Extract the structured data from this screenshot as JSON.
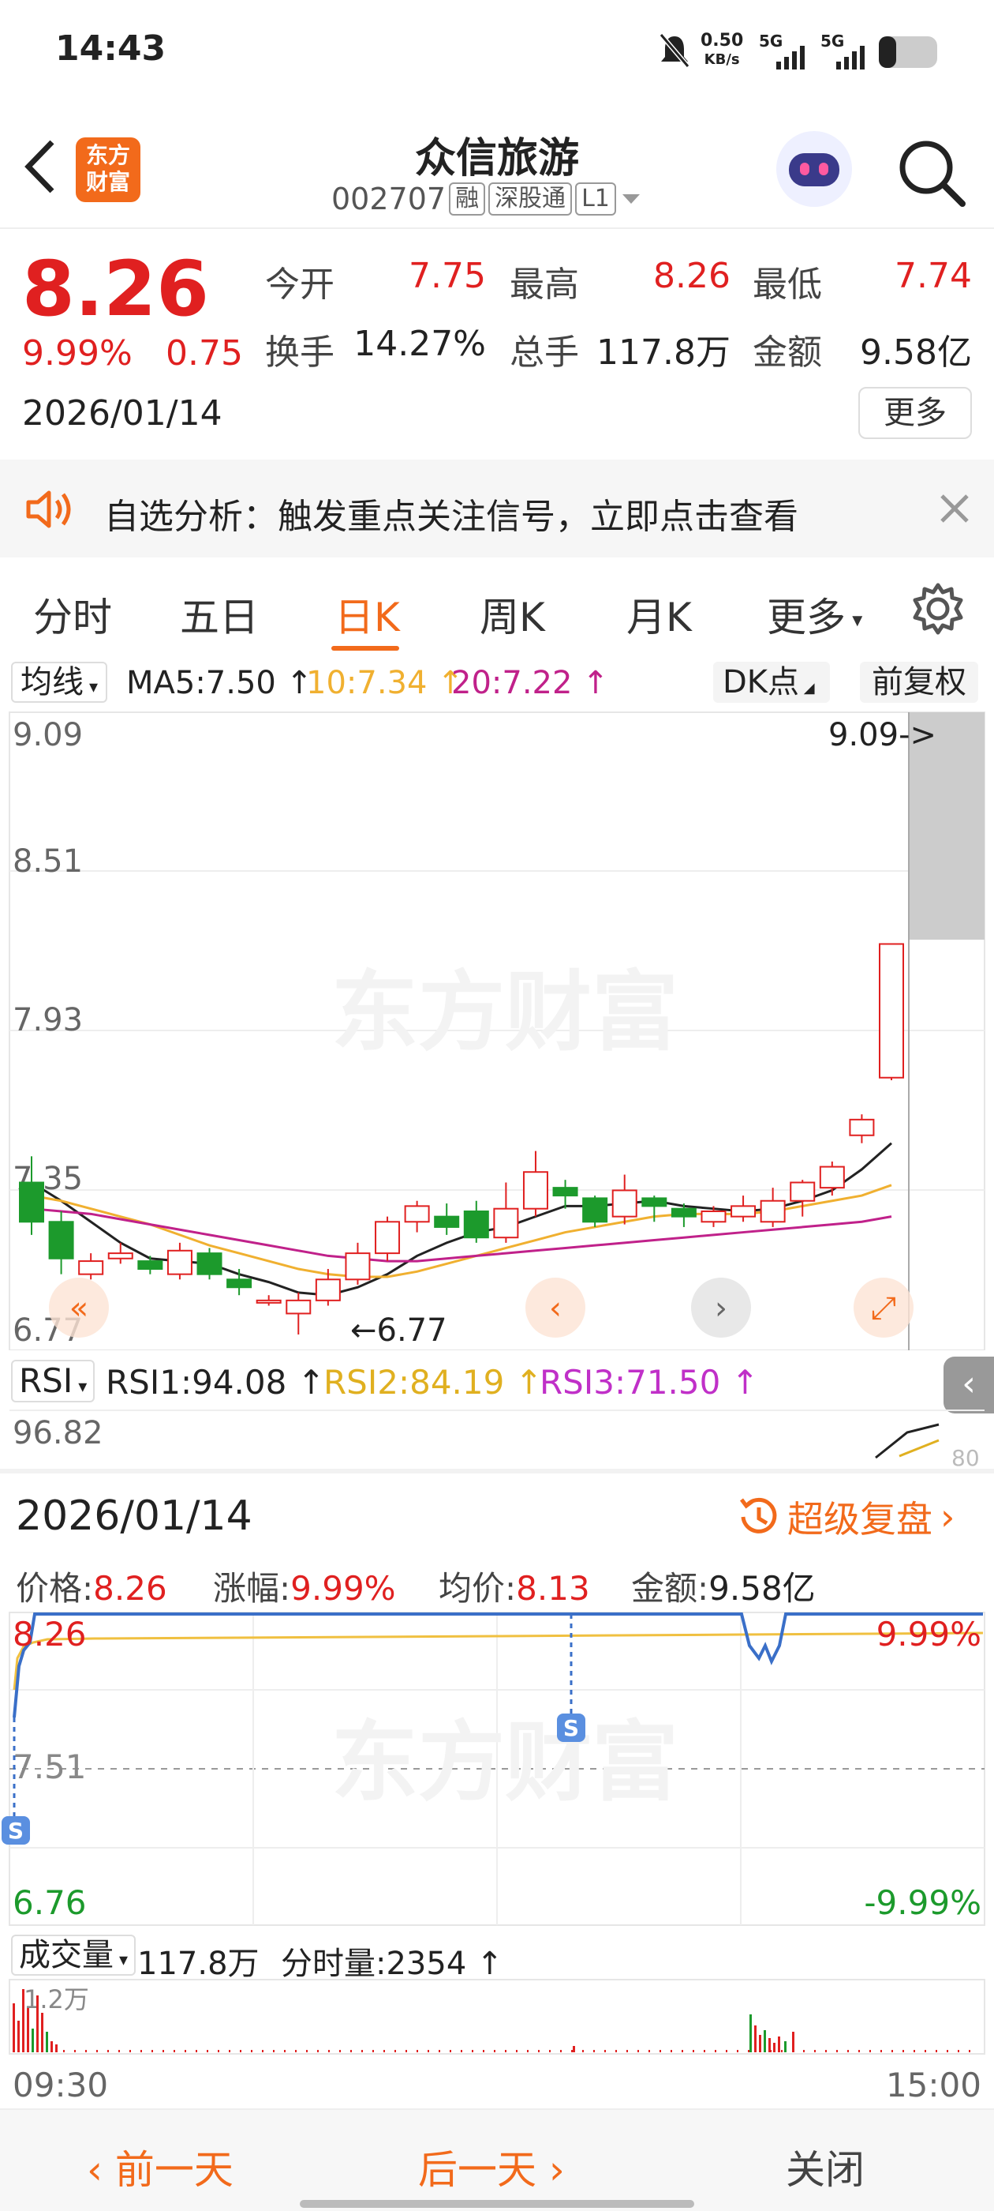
{
  "status": {
    "time": "14:43",
    "net_speed": "0.50",
    "net_unit": "KB/s",
    "sig1": "5G",
    "sig2": "5G"
  },
  "header": {
    "title": "众信旅游",
    "code": "002707",
    "tags": [
      "融",
      "深股通",
      "L1"
    ],
    "logo_text_1": "东方",
    "logo_text_2": "财富"
  },
  "quote": {
    "price": "8.26",
    "change_pct": "9.99%",
    "change": "0.75",
    "date": "2026/01/14",
    "open_label": "今开",
    "open": "7.75",
    "high_label": "最高",
    "high": "8.26",
    "low_label": "最低",
    "low": "7.74",
    "turnover_label": "换手",
    "turnover": "14.27%",
    "volume_label": "总手",
    "volume": "117.8万",
    "amount_label": "金额",
    "amount": "9.58亿",
    "more": "更多"
  },
  "notice": {
    "text": "自选分析：触发重点关注信号，立即点击查看"
  },
  "tabs": [
    {
      "label": "分时"
    },
    {
      "label": "五日"
    },
    {
      "label": "日K"
    },
    {
      "label": "周K"
    },
    {
      "label": "月K"
    },
    {
      "label": "更多"
    }
  ],
  "kline_bar": {
    "indicator": "均线",
    "ma5": "MA5:7.50",
    "ma10": "10:7.34",
    "ma20": "20:7.22",
    "dk": "DK点",
    "adjust": "前复权"
  },
  "kchart": {
    "y_labels": [
      "9.09",
      "8.51",
      "7.93",
      "7.35",
      "6.77"
    ],
    "max_marker": "9.09->",
    "min_marker": "6.77",
    "watermark": "东方财富",
    "candles": [
      {
        "o": 7.35,
        "c": 7.2,
        "h": 7.45,
        "l": 7.15
      },
      {
        "o": 7.2,
        "c": 7.06,
        "h": 7.24,
        "l": 7.0
      },
      {
        "o": 7.0,
        "c": 7.05,
        "h": 7.08,
        "l": 6.98
      },
      {
        "o": 7.06,
        "c": 7.08,
        "h": 7.12,
        "l": 7.04
      },
      {
        "o": 7.05,
        "c": 7.02,
        "h": 7.07,
        "l": 7.0
      },
      {
        "o": 7.0,
        "c": 7.09,
        "h": 7.12,
        "l": 6.98
      },
      {
        "o": 7.08,
        "c": 7.0,
        "h": 7.1,
        "l": 6.98
      },
      {
        "o": 6.98,
        "c": 6.95,
        "h": 7.02,
        "l": 6.92
      },
      {
        "o": 6.9,
        "c": 6.9,
        "h": 6.92,
        "l": 6.88
      },
      {
        "o": 6.85,
        "c": 6.9,
        "h": 6.93,
        "l": 6.77
      },
      {
        "o": 6.9,
        "c": 6.98,
        "h": 7.02,
        "l": 6.88
      },
      {
        "o": 6.98,
        "c": 7.08,
        "h": 7.12,
        "l": 6.96
      },
      {
        "o": 7.08,
        "c": 7.2,
        "h": 7.22,
        "l": 7.05
      },
      {
        "o": 7.2,
        "c": 7.26,
        "h": 7.28,
        "l": 7.16
      },
      {
        "o": 7.22,
        "c": 7.18,
        "h": 7.27,
        "l": 7.15
      },
      {
        "o": 7.24,
        "c": 7.14,
        "h": 7.28,
        "l": 7.12
      },
      {
        "o": 7.14,
        "c": 7.25,
        "h": 7.35,
        "l": 7.12
      },
      {
        "o": 7.25,
        "c": 7.39,
        "h": 7.47,
        "l": 7.22
      },
      {
        "o": 7.33,
        "c": 7.3,
        "h": 7.36,
        "l": 7.25
      },
      {
        "o": 7.29,
        "c": 7.2,
        "h": 7.3,
        "l": 7.18
      },
      {
        "o": 7.22,
        "c": 7.32,
        "h": 7.38,
        "l": 7.19
      },
      {
        "o": 7.29,
        "c": 7.26,
        "h": 7.3,
        "l": 7.2
      },
      {
        "o": 7.25,
        "c": 7.22,
        "h": 7.27,
        "l": 7.18
      },
      {
        "o": 7.2,
        "c": 7.24,
        "h": 7.26,
        "l": 7.18
      },
      {
        "o": 7.22,
        "c": 7.26,
        "h": 7.3,
        "l": 7.2
      },
      {
        "o": 7.2,
        "c": 7.28,
        "h": 7.33,
        "l": 7.18
      },
      {
        "o": 7.28,
        "c": 7.35,
        "h": 7.36,
        "l": 7.22
      },
      {
        "o": 7.33,
        "c": 7.41,
        "h": 7.43,
        "l": 7.3
      },
      {
        "o": 7.53,
        "c": 7.59,
        "h": 7.61,
        "l": 7.5
      },
      {
        "o": 7.75,
        "c": 8.26,
        "h": 8.26,
        "l": 7.74
      }
    ],
    "ma5": [
      7.35,
      7.28,
      7.2,
      7.12,
      7.06,
      7.05,
      7.04,
      7.0,
      6.97,
      6.93,
      6.92,
      6.95,
      7.0,
      7.07,
      7.12,
      7.16,
      7.18,
      7.22,
      7.26,
      7.26,
      7.27,
      7.28,
      7.26,
      7.25,
      7.24,
      7.25,
      7.28,
      7.32,
      7.4,
      7.5
    ],
    "ma10": [
      7.3,
      7.28,
      7.25,
      7.22,
      7.19,
      7.15,
      7.11,
      7.08,
      7.05,
      7.02,
      7.0,
      6.99,
      6.99,
      7.01,
      7.04,
      7.07,
      7.1,
      7.13,
      7.16,
      7.18,
      7.2,
      7.22,
      7.23,
      7.23,
      7.23,
      7.24,
      7.26,
      7.28,
      7.3,
      7.34
    ],
    "ma20": [
      7.25,
      7.24,
      7.23,
      7.21,
      7.19,
      7.17,
      7.15,
      7.13,
      7.11,
      7.09,
      7.07,
      7.06,
      7.05,
      7.05,
      7.06,
      7.07,
      7.08,
      7.09,
      7.1,
      7.11,
      7.12,
      7.13,
      7.14,
      7.15,
      7.16,
      7.17,
      7.18,
      7.19,
      7.2,
      7.22
    ]
  },
  "rsi_bar": {
    "name": "RSI",
    "rsi1": "RSI1:94.08",
    "rsi2": "RSI2:84.19",
    "rsi3": "RSI3:71.50",
    "top": "96.82",
    "edge": "80"
  },
  "detail": {
    "date": "2026/01/14",
    "replay": "超级复盘",
    "price_label": "价格:",
    "price": "8.26",
    "chg_label": "涨幅:",
    "chg": "9.99%",
    "avg_label": "均价:",
    "avg": "8.13",
    "amt_label": "金额:",
    "amt": "9.58亿"
  },
  "intraday": {
    "top": "8.26",
    "mid": "7.51",
    "bottom": "6.76",
    "top_pct": "9.99%",
    "bottom_pct": "-9.99%",
    "watermark": "东方财富",
    "mark": "S"
  },
  "volume": {
    "label": "成交量",
    "total": "117.8万",
    "tick": "分时量:2354",
    "scale": "1.2万",
    "t_start": "09:30",
    "t_end": "15:00"
  },
  "footer": {
    "prev": "前一天",
    "next": "后一天",
    "close": "关闭"
  },
  "colors": {
    "up": "#e02020",
    "down": "#1c9a2c",
    "accent": "#f26a1b",
    "ma5": "#222222",
    "ma10": "#f0b030",
    "ma20": "#c0218a"
  }
}
